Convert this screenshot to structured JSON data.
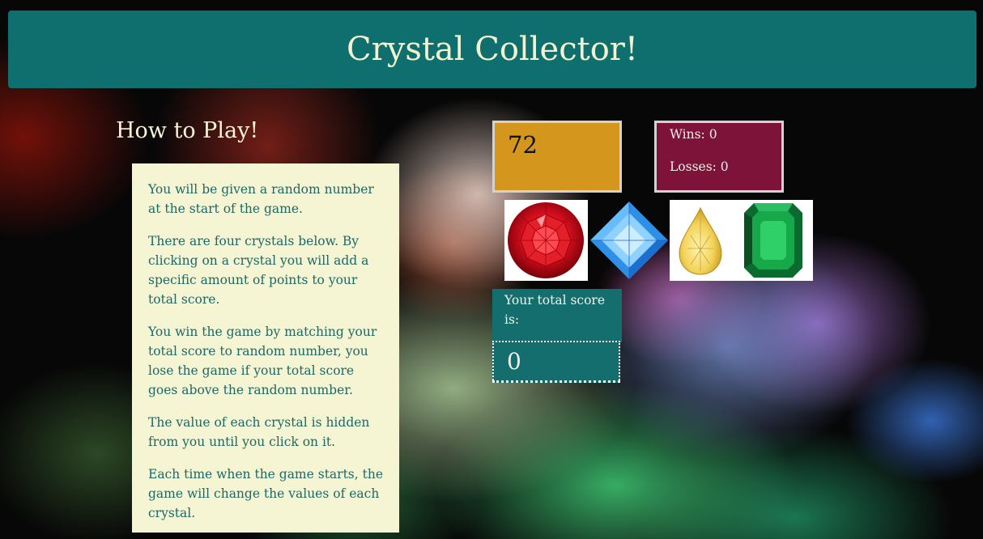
{
  "header": {
    "title": "Crystal Collector!"
  },
  "instructions": {
    "title": "How to Play!",
    "paragraphs": [
      "You will be given a random number at the start of the game.",
      "There are four crystals below. By clicking on a crystal you will add a specific amount of points to your total score.",
      "You win the game by matching your total score to random number, you lose the game if your total score goes above the random number.",
      "The value of each crystal is hidden from you until you click on it.",
      "Each time when the game starts, the game will change the values of each crystal."
    ]
  },
  "game": {
    "target_number": "72",
    "wins_label": "Wins: 0",
    "losses_label": "Losses: 0",
    "score_label": "Your total score is:",
    "score_value": "0",
    "crystals": [
      {
        "icon": "red-round-gem-icon",
        "color": "#d6101a"
      },
      {
        "icon": "blue-square-gem-icon",
        "color": "#3aa7f5"
      },
      {
        "icon": "yellow-pear-gem-icon",
        "color": "#f0d35a"
      },
      {
        "icon": "green-emerald-gem-icon",
        "color": "#0f8a3c"
      }
    ]
  },
  "colors": {
    "header_bg": "#0f6e6e",
    "header_text": "#f3f3cf",
    "instructions_bg": "#f5f4d3",
    "instructions_text": "#1c6a66",
    "target_bg": "#d4961c",
    "record_bg": "#7d1339",
    "score_bg": "#136e6d"
  }
}
